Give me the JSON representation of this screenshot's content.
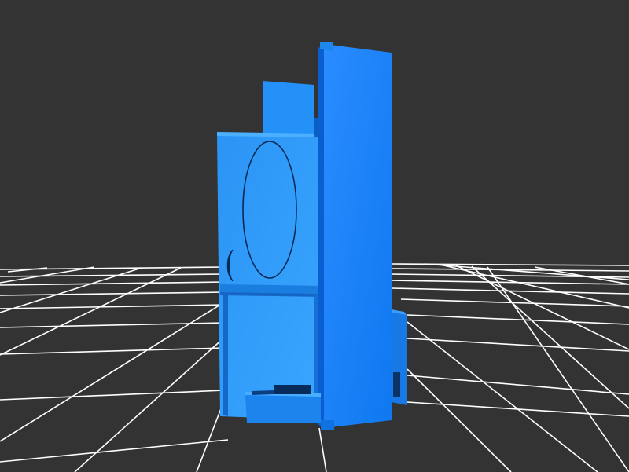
{
  "scene": {
    "background_color": "#333333",
    "grid_color": "#ffffff",
    "model_color": "#1e90ff",
    "model_shade_dark": "#0a5fb8",
    "model_shade_light": "#3aa7ff"
  }
}
